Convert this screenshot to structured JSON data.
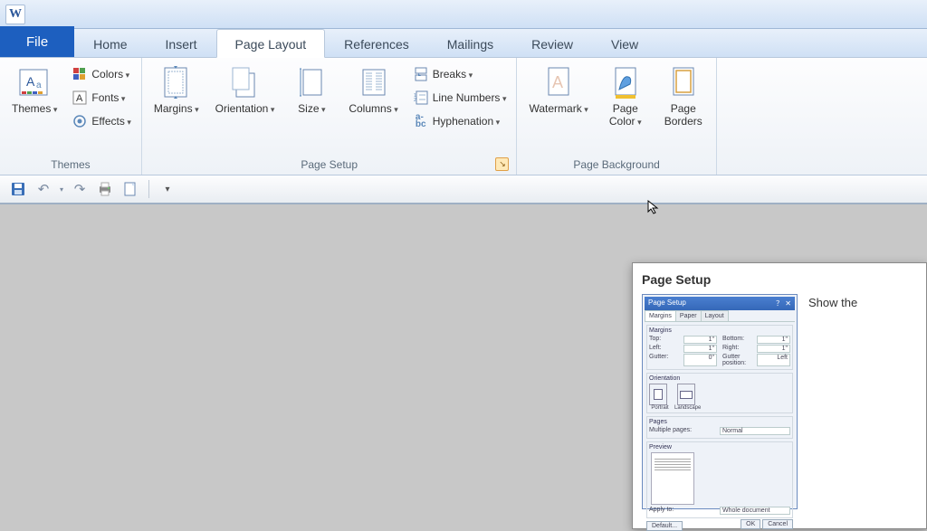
{
  "app_icon_letter": "W",
  "tabs": {
    "file": "File",
    "items": [
      "Home",
      "Insert",
      "Page Layout",
      "References",
      "Mailings",
      "Review",
      "View"
    ],
    "active_index": 2
  },
  "ribbon": {
    "themes": {
      "group_label": "Themes",
      "themes_btn": "Themes",
      "colors": "Colors",
      "fonts": "Fonts",
      "effects": "Effects"
    },
    "page_setup": {
      "group_label": "Page Setup",
      "margins": "Margins",
      "orientation": "Orientation",
      "size": "Size",
      "columns": "Columns",
      "breaks": "Breaks",
      "line_numbers": "Line Numbers",
      "hyphenation": "Hyphenation"
    },
    "page_background": {
      "group_label": "Page Background",
      "watermark": "Watermark",
      "page_color": "Page\nColor",
      "page_borders": "Page\nBorders"
    }
  },
  "tooltip": {
    "title": "Page Setup",
    "text": "Show the",
    "dialog": {
      "window_title": "Page Setup",
      "tabs": [
        "Margins",
        "Paper",
        "Layout"
      ],
      "section_margins": "Margins",
      "labels": {
        "top": "Top:",
        "bottom": "Bottom:",
        "left": "Left:",
        "right": "Right:",
        "gutter": "Gutter:",
        "gutter_pos": "Gutter position:"
      },
      "values": {
        "top": "1\"",
        "bottom": "1\"",
        "left": "1\"",
        "right": "1\"",
        "gutter": "0\"",
        "gutter_pos": "Left"
      },
      "section_orientation": "Orientation",
      "orientation_portrait": "Portrait",
      "orientation_landscape": "Landscape",
      "section_pages": "Pages",
      "multiple_pages": "Multiple pages:",
      "multiple_pages_value": "Normal",
      "section_preview": "Preview",
      "apply_to": "Apply to:",
      "apply_to_value": "Whole document",
      "btn_default": "Default...",
      "btn_ok": "OK",
      "btn_cancel": "Cancel"
    }
  }
}
